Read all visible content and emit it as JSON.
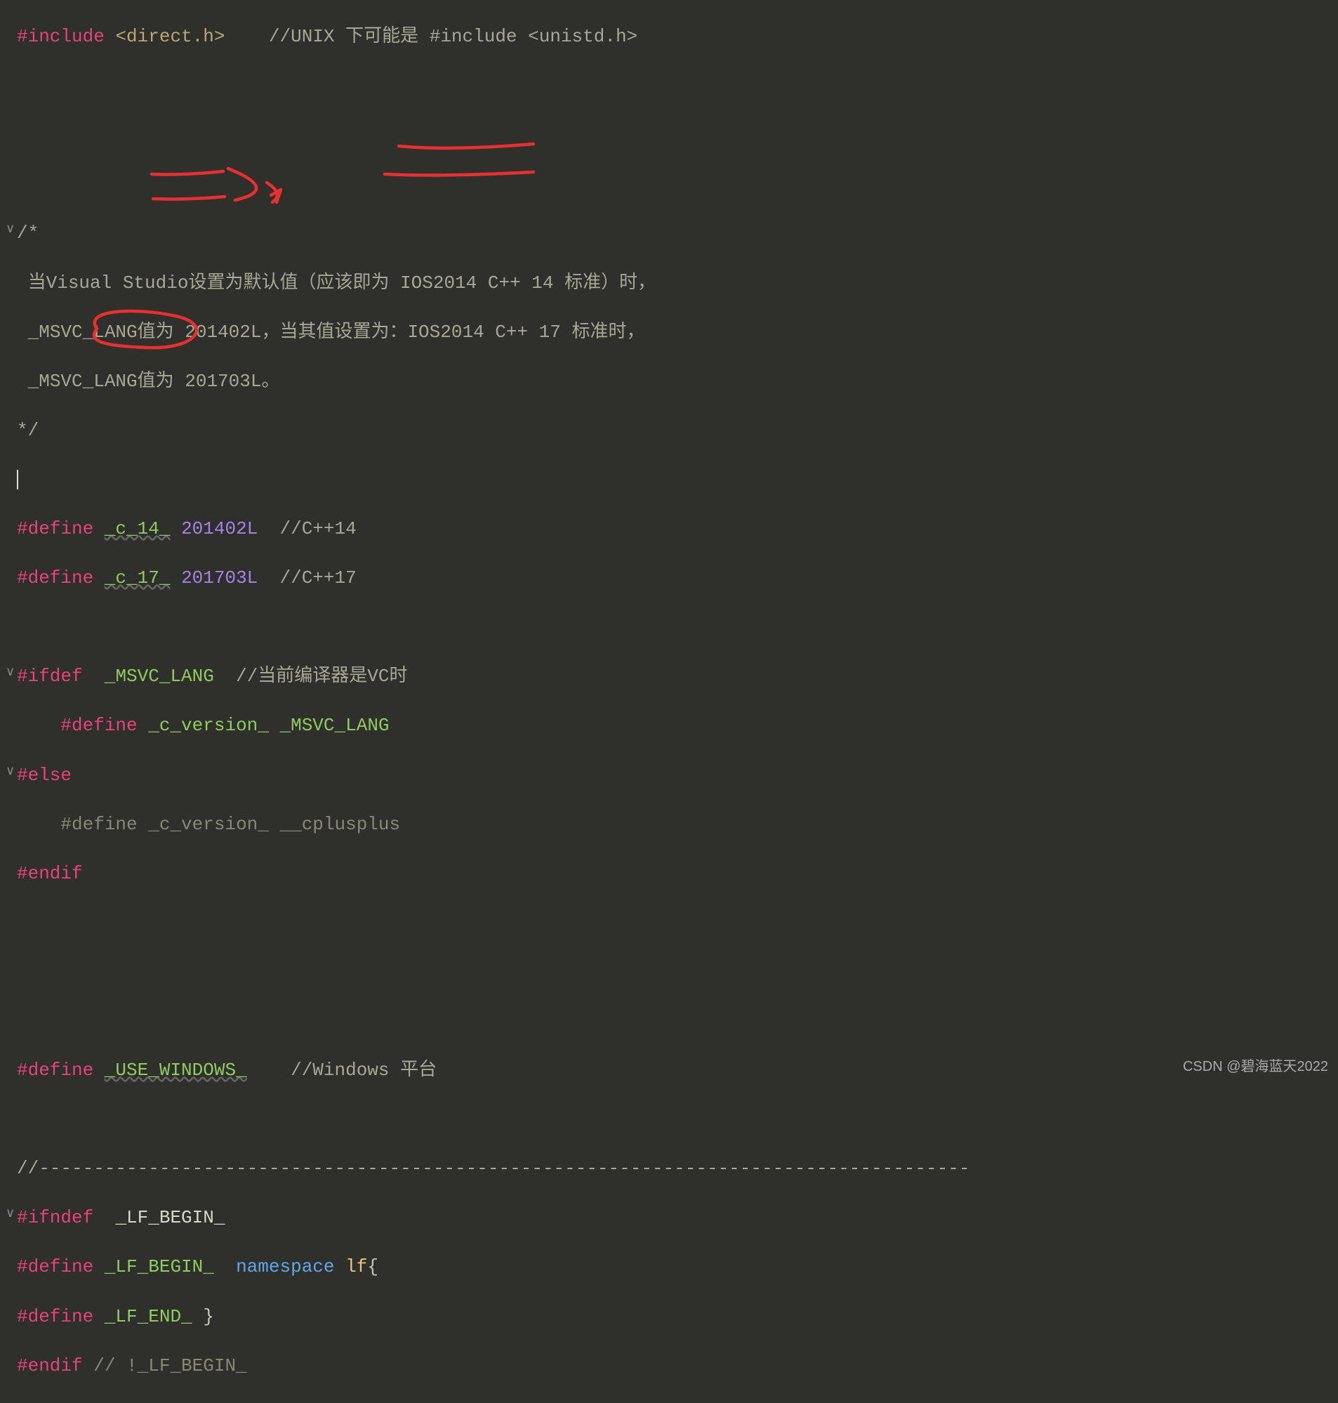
{
  "code": {
    "l1": {
      "pre": "#include",
      "hdr": "<direct.h>",
      "cmt": "//UNIX 下可能是 #include <unistd.h>"
    },
    "l5": "/*",
    "l6": "当Visual Studio设置为默认值（应该即为 IOS2014 C++ 14 标准）时，",
    "l7": "_MSVC_LANG值为 201402L，当其值设置为：IOS2014 C++ 17 标准时，",
    "l8": "_MSVC_LANG值为 201703L。",
    "l9": "*/",
    "l11": {
      "pre": "#define",
      "name": "_c_14_",
      "val": "201402L",
      "cmt": "//C++14"
    },
    "l12": {
      "pre": "#define",
      "name": "_c_17_",
      "val": "201703L",
      "cmt": "//C++17"
    },
    "l14": {
      "pre": "#ifdef",
      "name": "_MSVC_LANG",
      "cmt": "//当前编译器是VC时"
    },
    "l15": {
      "pre": "#define",
      "name": "_c_version_",
      "val": "_MSVC_LANG"
    },
    "l16": {
      "pre": "#else"
    },
    "l17": {
      "pre": "#define",
      "name": "_c_version_",
      "val": "__cplusplus"
    },
    "l18": {
      "pre": "#endif"
    },
    "l22": {
      "pre": "#define",
      "name": "_USE_WINDOWS_",
      "cmt": "//Windows 平台"
    },
    "l24": "//-------------------------------------------------------------------------------------",
    "l25": {
      "pre": "#ifndef",
      "name": "_LF_BEGIN_"
    },
    "l26": {
      "pre": "#define",
      "name": "_LF_BEGIN_",
      "kw": "namespace",
      "id": "lf",
      "br": "{"
    },
    "l27": {
      "pre": "#define",
      "name": "_LF_END_",
      "br": "}"
    },
    "l28": {
      "pre": "#endif",
      "cmt": "// !_LF_BEGIN_"
    }
  },
  "watermark": "CSDN @碧海蓝天2022",
  "fold_marker": "∨"
}
